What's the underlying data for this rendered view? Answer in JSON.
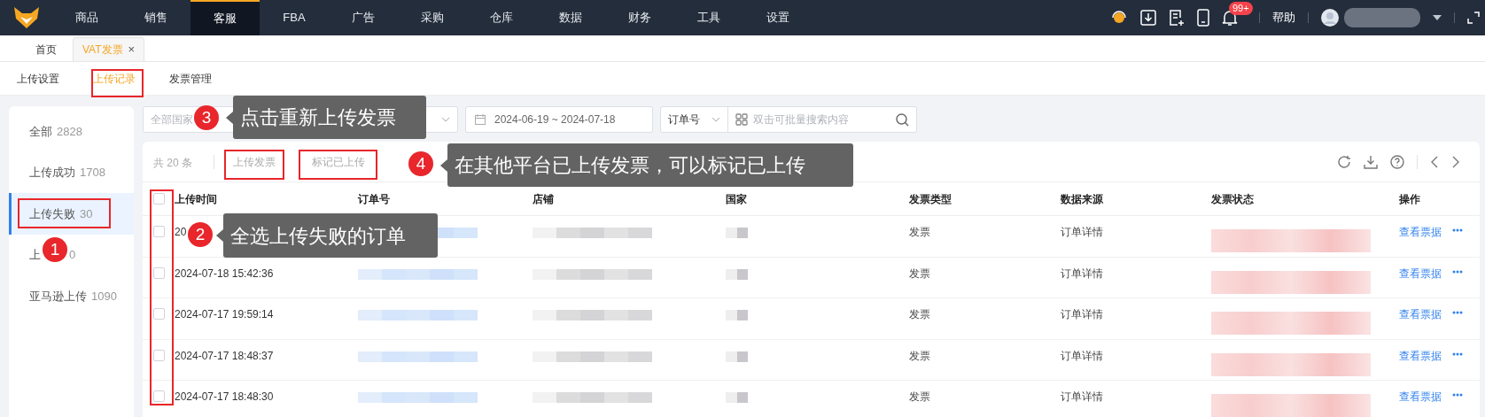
{
  "nav": {
    "items": [
      {
        "label": "商品",
        "selected": false
      },
      {
        "label": "销售",
        "selected": false
      },
      {
        "label": "客服",
        "selected": true
      },
      {
        "label": "FBA",
        "selected": false
      },
      {
        "label": "广告",
        "selected": false
      },
      {
        "label": "采购",
        "selected": false
      },
      {
        "label": "仓库",
        "selected": false
      },
      {
        "label": "数据",
        "selected": false
      },
      {
        "label": "财务",
        "selected": false
      },
      {
        "label": "工具",
        "selected": false
      },
      {
        "label": "设置",
        "selected": false
      }
    ],
    "notification_badge": "99+",
    "help": "帮助"
  },
  "page_tabs": [
    {
      "label": "首页",
      "selected": false
    },
    {
      "label": "VAT发票",
      "selected": true,
      "close": "×"
    }
  ],
  "sub_tabs": [
    {
      "label": "上传设置",
      "selected": false
    },
    {
      "label": "上传记录",
      "selected": true
    },
    {
      "label": "发票管理",
      "selected": false
    }
  ],
  "sidebar": {
    "items": [
      {
        "label": "全部",
        "count": "2828",
        "selected": false
      },
      {
        "label": "上传成功",
        "count": "1708",
        "selected": false
      },
      {
        "label": "上传失败",
        "count": "30",
        "selected": true
      },
      {
        "label": "上",
        "count": "0",
        "selected": false
      },
      {
        "label": "亚马逊上传",
        "count": "1090",
        "selected": false
      }
    ]
  },
  "filters": {
    "country": {
      "placeholder": "全部国家"
    },
    "date_range": {
      "start": "2024-06-19",
      "separator": "~",
      "end": "2024-07-18"
    },
    "search": {
      "field": "订单号",
      "placeholder": "双击可批量搜索内容"
    }
  },
  "table": {
    "total": "共 20 条",
    "actions": [
      {
        "label": "上传发票",
        "disabled": true
      },
      {
        "label": "标记已上传",
        "disabled": true
      }
    ],
    "header_checked": false,
    "columns": [
      "上传时间",
      "订单号",
      "店铺",
      "国家",
      "发票类型",
      "数据来源",
      "发票状态",
      "操作"
    ],
    "rows": [
      {
        "checked": false,
        "upload_time": "20",
        "invoice_type": "发票",
        "source": "订单详情",
        "action": "查看票据"
      },
      {
        "checked": false,
        "upload_time": "2024-07-18 15:42:36",
        "invoice_type": "发票",
        "source": "订单详情",
        "action": "查看票据"
      },
      {
        "checked": false,
        "upload_time": "2024-07-17 19:59:14",
        "invoice_type": "发票",
        "source": "订单详情",
        "action": "查看票据"
      },
      {
        "checked": false,
        "upload_time": "2024-07-17 18:48:37",
        "invoice_type": "发票",
        "source": "订单详情",
        "action": "查看票据"
      },
      {
        "checked": false,
        "upload_time": "2024-07-17 18:48:30",
        "invoice_type": "发票",
        "source": "订单详情",
        "action": "查看票据"
      }
    ]
  },
  "annotations": [
    {
      "number": "3",
      "text": "点击重新上传发票"
    },
    {
      "number": "4",
      "text": "在其他平台已上传发票，可以标记已上传"
    },
    {
      "number": "2",
      "text": "全选上传失败的订单"
    },
    {
      "number": "1"
    }
  ]
}
